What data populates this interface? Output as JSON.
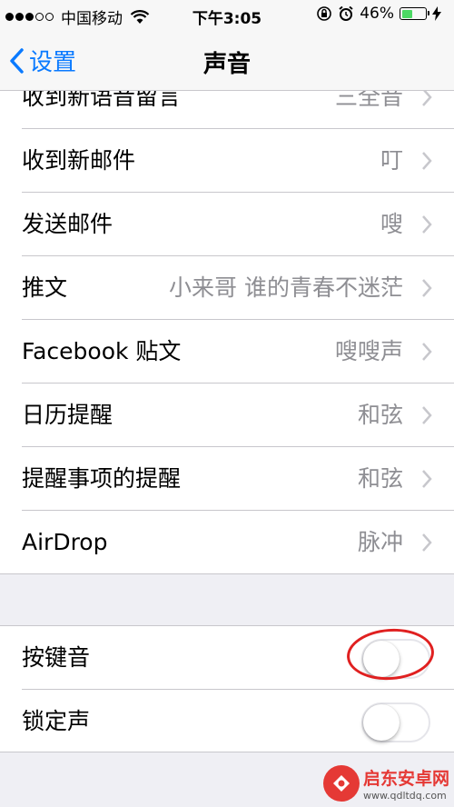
{
  "status_bar": {
    "carrier": "中国移动",
    "time": "下午3:05",
    "battery_percent": "46%",
    "battery_level": 0.46,
    "signal_dots_filled": 3,
    "signal_dots_total": 5,
    "icons": [
      "signal-dots-icon",
      "wifi-icon",
      "rotation-lock-icon",
      "alarm-icon",
      "battery-icon",
      "charging-bolt-icon"
    ]
  },
  "nav": {
    "back_label": "设置",
    "title": "声音"
  },
  "sounds": {
    "items": [
      {
        "label": "收到新语音留言",
        "value": "三全音"
      },
      {
        "label": "收到新邮件",
        "value": "叮"
      },
      {
        "label": "发送邮件",
        "value": "嗖"
      },
      {
        "label": "推文",
        "value": "小来哥 谁的青春不迷茫"
      },
      {
        "label": "Facebook 贴文",
        "value": "嗖嗖声"
      },
      {
        "label": "日历提醒",
        "value": "和弦"
      },
      {
        "label": "提醒事项的提醒",
        "value": "和弦"
      },
      {
        "label": "AirDrop",
        "value": "脉冲"
      }
    ]
  },
  "toggles": {
    "items": [
      {
        "label": "按键音",
        "on": false
      },
      {
        "label": "锁定声",
        "on": false
      }
    ]
  },
  "watermark": {
    "name": "启东安卓网",
    "url": "www.qdltdq.com"
  },
  "colors": {
    "accent": "#0a7aff",
    "battery_fill": "#4cd964",
    "annotation": "#e02020",
    "watermark": "#e53935"
  }
}
